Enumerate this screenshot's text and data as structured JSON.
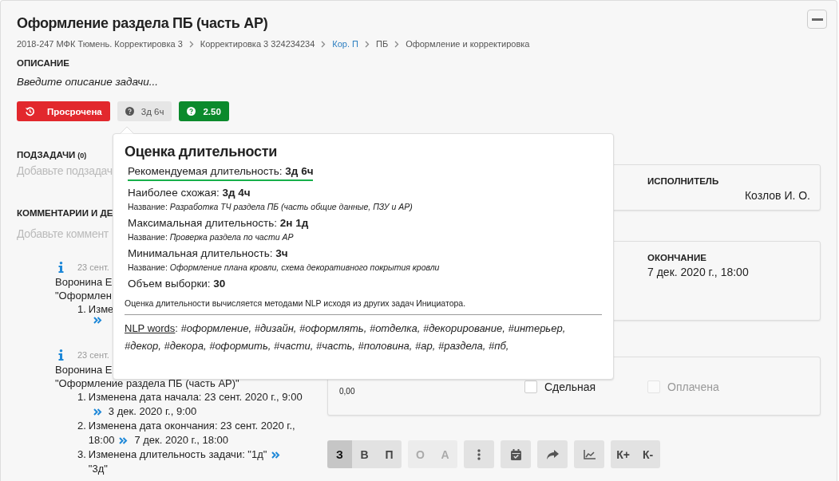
{
  "title": "Оформление раздела ПБ (часть АР)",
  "breadcrumbs": [
    {
      "label": "2018-247 МФК Тюмень. Корректировка 3",
      "link": false
    },
    {
      "label": "Корректировка 3 324234234",
      "link": false
    },
    {
      "label": "Кор. П",
      "link": true
    },
    {
      "label": "ПБ",
      "link": false
    },
    {
      "label": "Оформление и корректировка",
      "link": false
    }
  ],
  "description": {
    "label": "ОПИСАНИЕ",
    "hint": "Введите описание задачи..."
  },
  "badges": [
    {
      "kind": "overdue",
      "label": "Просрочена"
    },
    {
      "kind": "estimate",
      "label": "3д 6ч"
    },
    {
      "kind": "score",
      "label": "2.50"
    }
  ],
  "subtasks": {
    "label": "ПОДЗАДАЧИ",
    "count": "(0)",
    "placeholder": "Добавьте подзадач"
  },
  "comments": {
    "label": "КОММЕНТАРИИ И ДЕ",
    "placeholder": "Добавьте коммент",
    "items": [
      {
        "date": "23 сент.",
        "author": "Воронина Е",
        "subject": "\"Оформлен",
        "changes": [
          {
            "num": "1.",
            "lines": [
              [
                {
                  "kind": "text",
                  "text": "Изме"
                }
              ],
              [
                {
                  "kind": "arrow"
                }
              ]
            ]
          }
        ]
      },
      {
        "date": "23 сент.",
        "author": "Воронина Е",
        "subject": "\"Оформление раздела ПБ (часть АР)\"",
        "changes": [
          {
            "num": "1.",
            "lines": [
              [
                {
                  "kind": "text",
                  "text": "Изменена дата начала: 23 сент. 2020 г., 9:00"
                }
              ],
              [
                {
                  "kind": "arrow"
                },
                {
                  "kind": "text",
                  "text": "3 дек. 2020 г., 9:00"
                }
              ]
            ]
          },
          {
            "num": "2.",
            "lines": [
              [
                {
                  "kind": "text",
                  "text": "Изменена дата окончания: 23 сент. 2020 г.,"
                }
              ],
              [
                {
                  "kind": "text",
                  "text": "18:00"
                },
                {
                  "kind": "arrow"
                },
                {
                  "kind": "text",
                  "text": "7 дек. 2020 г., 18:00"
                }
              ]
            ]
          },
          {
            "num": "3.",
            "lines": [
              [
                {
                  "kind": "text",
                  "text": "Изменена длительность задачи: \"1д\""
                },
                {
                  "kind": "arrow"
                }
              ],
              [
                {
                  "kind": "text",
                  "text": "\"3д\""
                }
              ]
            ]
          }
        ]
      }
    ]
  },
  "cards": [
    {
      "kind": "assignee",
      "label": "ИСПОЛНИТЕЛЬ",
      "value": "Козлов И. О."
    },
    {
      "kind": "date",
      "label": "ОКОНЧАНИЕ",
      "value": "7 дек. 2020 г., 18:00"
    }
  ],
  "payment": {
    "amount": "0,00",
    "options": [
      {
        "label": "Сдельная",
        "checked": false,
        "disabled": false
      },
      {
        "label": "Оплачена",
        "checked": false,
        "disabled": true
      }
    ]
  },
  "toolbar": [
    {
      "kind": "letters",
      "buttons": [
        {
          "label": "З",
          "selected": true,
          "disabled": false
        },
        {
          "label": "В",
          "selected": false,
          "disabled": false
        },
        {
          "label": "П",
          "selected": false,
          "disabled": false
        }
      ]
    },
    {
      "kind": "letters",
      "buttons": [
        {
          "label": "О",
          "selected": false,
          "disabled": true
        },
        {
          "label": "А",
          "selected": false,
          "disabled": true
        }
      ]
    },
    {
      "kind": "more"
    },
    {
      "kind": "calendar"
    },
    {
      "kind": "forward"
    },
    {
      "kind": "chart"
    },
    {
      "kind": "letters",
      "buttons": [
        {
          "label": "К+",
          "selected": false,
          "disabled": false
        },
        {
          "label": "К-",
          "selected": false,
          "disabled": false
        }
      ]
    }
  ],
  "popover": {
    "title": "Оценка длительности",
    "rows": [
      {
        "text": "Рекомендуемая длительность: **3д 6ч**",
        "highlighted": true
      },
      {
        "text": "Наиболее схожая: **3д 4ч**",
        "highlighted": false,
        "name": "Название: *Разработка ТЧ раздела ПБ (часть общие данные, ПЗУ и АР)*"
      },
      {
        "text": "Максимальная длительность: **2н 1д**",
        "highlighted": false,
        "name": "Название: *Проверка раздела по части АР*"
      },
      {
        "text": "Минимальная длительность: **3ч**",
        "highlighted": false,
        "name": "Название: *Оформление плана кровли, схема декоративного покрытия кровли*"
      },
      {
        "text": "Объем выборки: **30**",
        "highlighted": false
      }
    ],
    "note": "Оценка длительности вычисляется методами NLP исходя из других задач Инициатора.",
    "nlp_label": "NLP words",
    "nlp_words": ": *#оформление, #дизайн, #оформлять, #отделка, #декорирование, #интерьер, #декор, #декора, #оформить, #части, #часть, #половина, #ар, #раздела, #пб,*"
  }
}
